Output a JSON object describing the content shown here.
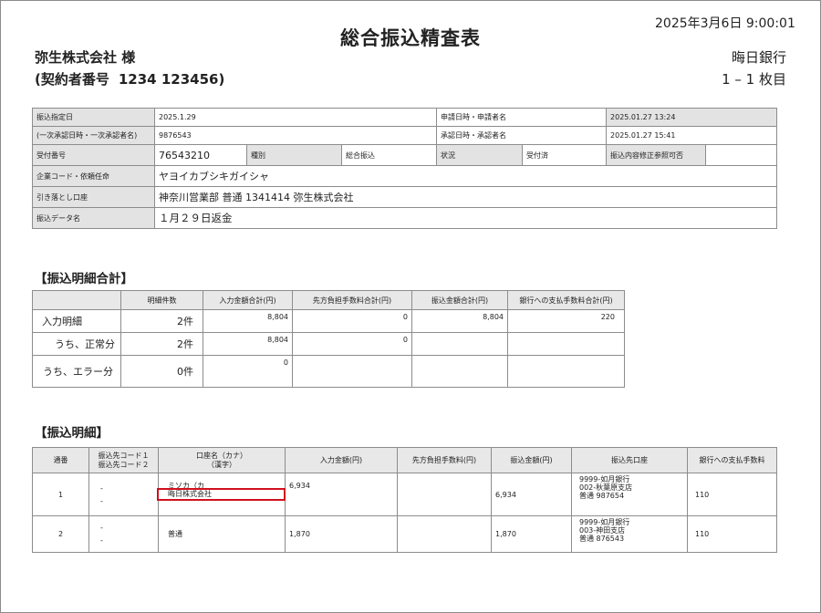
{
  "header": {
    "title": "総合振込精査表",
    "datetime": "2025年3月6日 9:00:01",
    "company": "弥生株式会社 様",
    "contract_label": "(契約者番号",
    "contract_number": "1234 123456)",
    "bank": "晦日銀行",
    "pages": "1 – 1 枚目"
  },
  "info": {
    "r1": {
      "l1": "振込指定日",
      "v1": "2025.1.29",
      "l2": "申請日時・申請者名",
      "v2": "2025.01.27 13:24"
    },
    "r2": {
      "l1": "(一次承認日時・一次承認者名)",
      "v1": "9876543",
      "l2": "承認日時・承認者名",
      "v2": "2025.01.27 15:41"
    },
    "r3": {
      "l1": "受付番号",
      "v1": "76543210",
      "l2": "種別",
      "v2": "総合振込",
      "l3": "状況",
      "v3": "受付済",
      "l4": "振込内容修正参照可否",
      "v4": ""
    },
    "r4": {
      "l1": "企業コード・依頼任命",
      "v1": "ヤヨイカブシキガイシャ"
    },
    "r5": {
      "l1": "引き落とし口座",
      "v1": "神奈川営業部 普通 1341414 弥生株式会社"
    },
    "r6": {
      "l1": "振込データ名",
      "v1": "１月２９日返金"
    }
  },
  "summary": {
    "section_title": "【振込明細合計】",
    "headers": [
      "",
      "明細件数",
      "入力金額合計(円)",
      "先方負担手数料合計(円)",
      "振込金額合計(円)",
      "銀行への支払手数料合計(円)"
    ],
    "rows": [
      {
        "label": "入力明細",
        "count": "2件",
        "input": "8,804",
        "fee": "0",
        "transfer": "8,804",
        "bank_fee": "220"
      },
      {
        "label": "うち、正常分",
        "count": "2件",
        "input": "8,804",
        "fee": "0",
        "transfer": "",
        "bank_fee": ""
      },
      {
        "label": "うち、エラー分",
        "count": "0件",
        "input": "0",
        "fee": "",
        "transfer": "",
        "bank_fee": ""
      }
    ]
  },
  "detail": {
    "section_title": "【振込明細】",
    "headers": {
      "seq": "通番",
      "code1": "振込先コード１",
      "code2": "振込先コード２",
      "name1": "口座名（カナ）",
      "name2": "（漢字）",
      "input": "入力金額(円)",
      "fee": "先方負担手数料(円)",
      "amount": "振込金額(円)",
      "dest": "振込先口座",
      "bank_fee": "銀行への支払手数料"
    },
    "rows": [
      {
        "seq": "1",
        "code1": "-",
        "code2": "-",
        "kana": "ミソカ（カ",
        "kanji": "晦日株式会社",
        "input": "6,934",
        "fee": "",
        "amount": "6,934",
        "dest1": "9999-如月銀行",
        "dest2": "002-秋葉原支店",
        "dest3": "普通 987654",
        "bank_fee": "110"
      },
      {
        "seq": "2",
        "code1": "-",
        "code2": "-",
        "kana": "普通",
        "kanji": "",
        "input": "1,870",
        "fee": "",
        "amount": "1,870",
        "dest1": "9999-如月銀行",
        "dest2": "003-神田支店",
        "dest3": "普通 876543",
        "bank_fee": "110"
      }
    ]
  },
  "highlight_color": "#d0101d"
}
